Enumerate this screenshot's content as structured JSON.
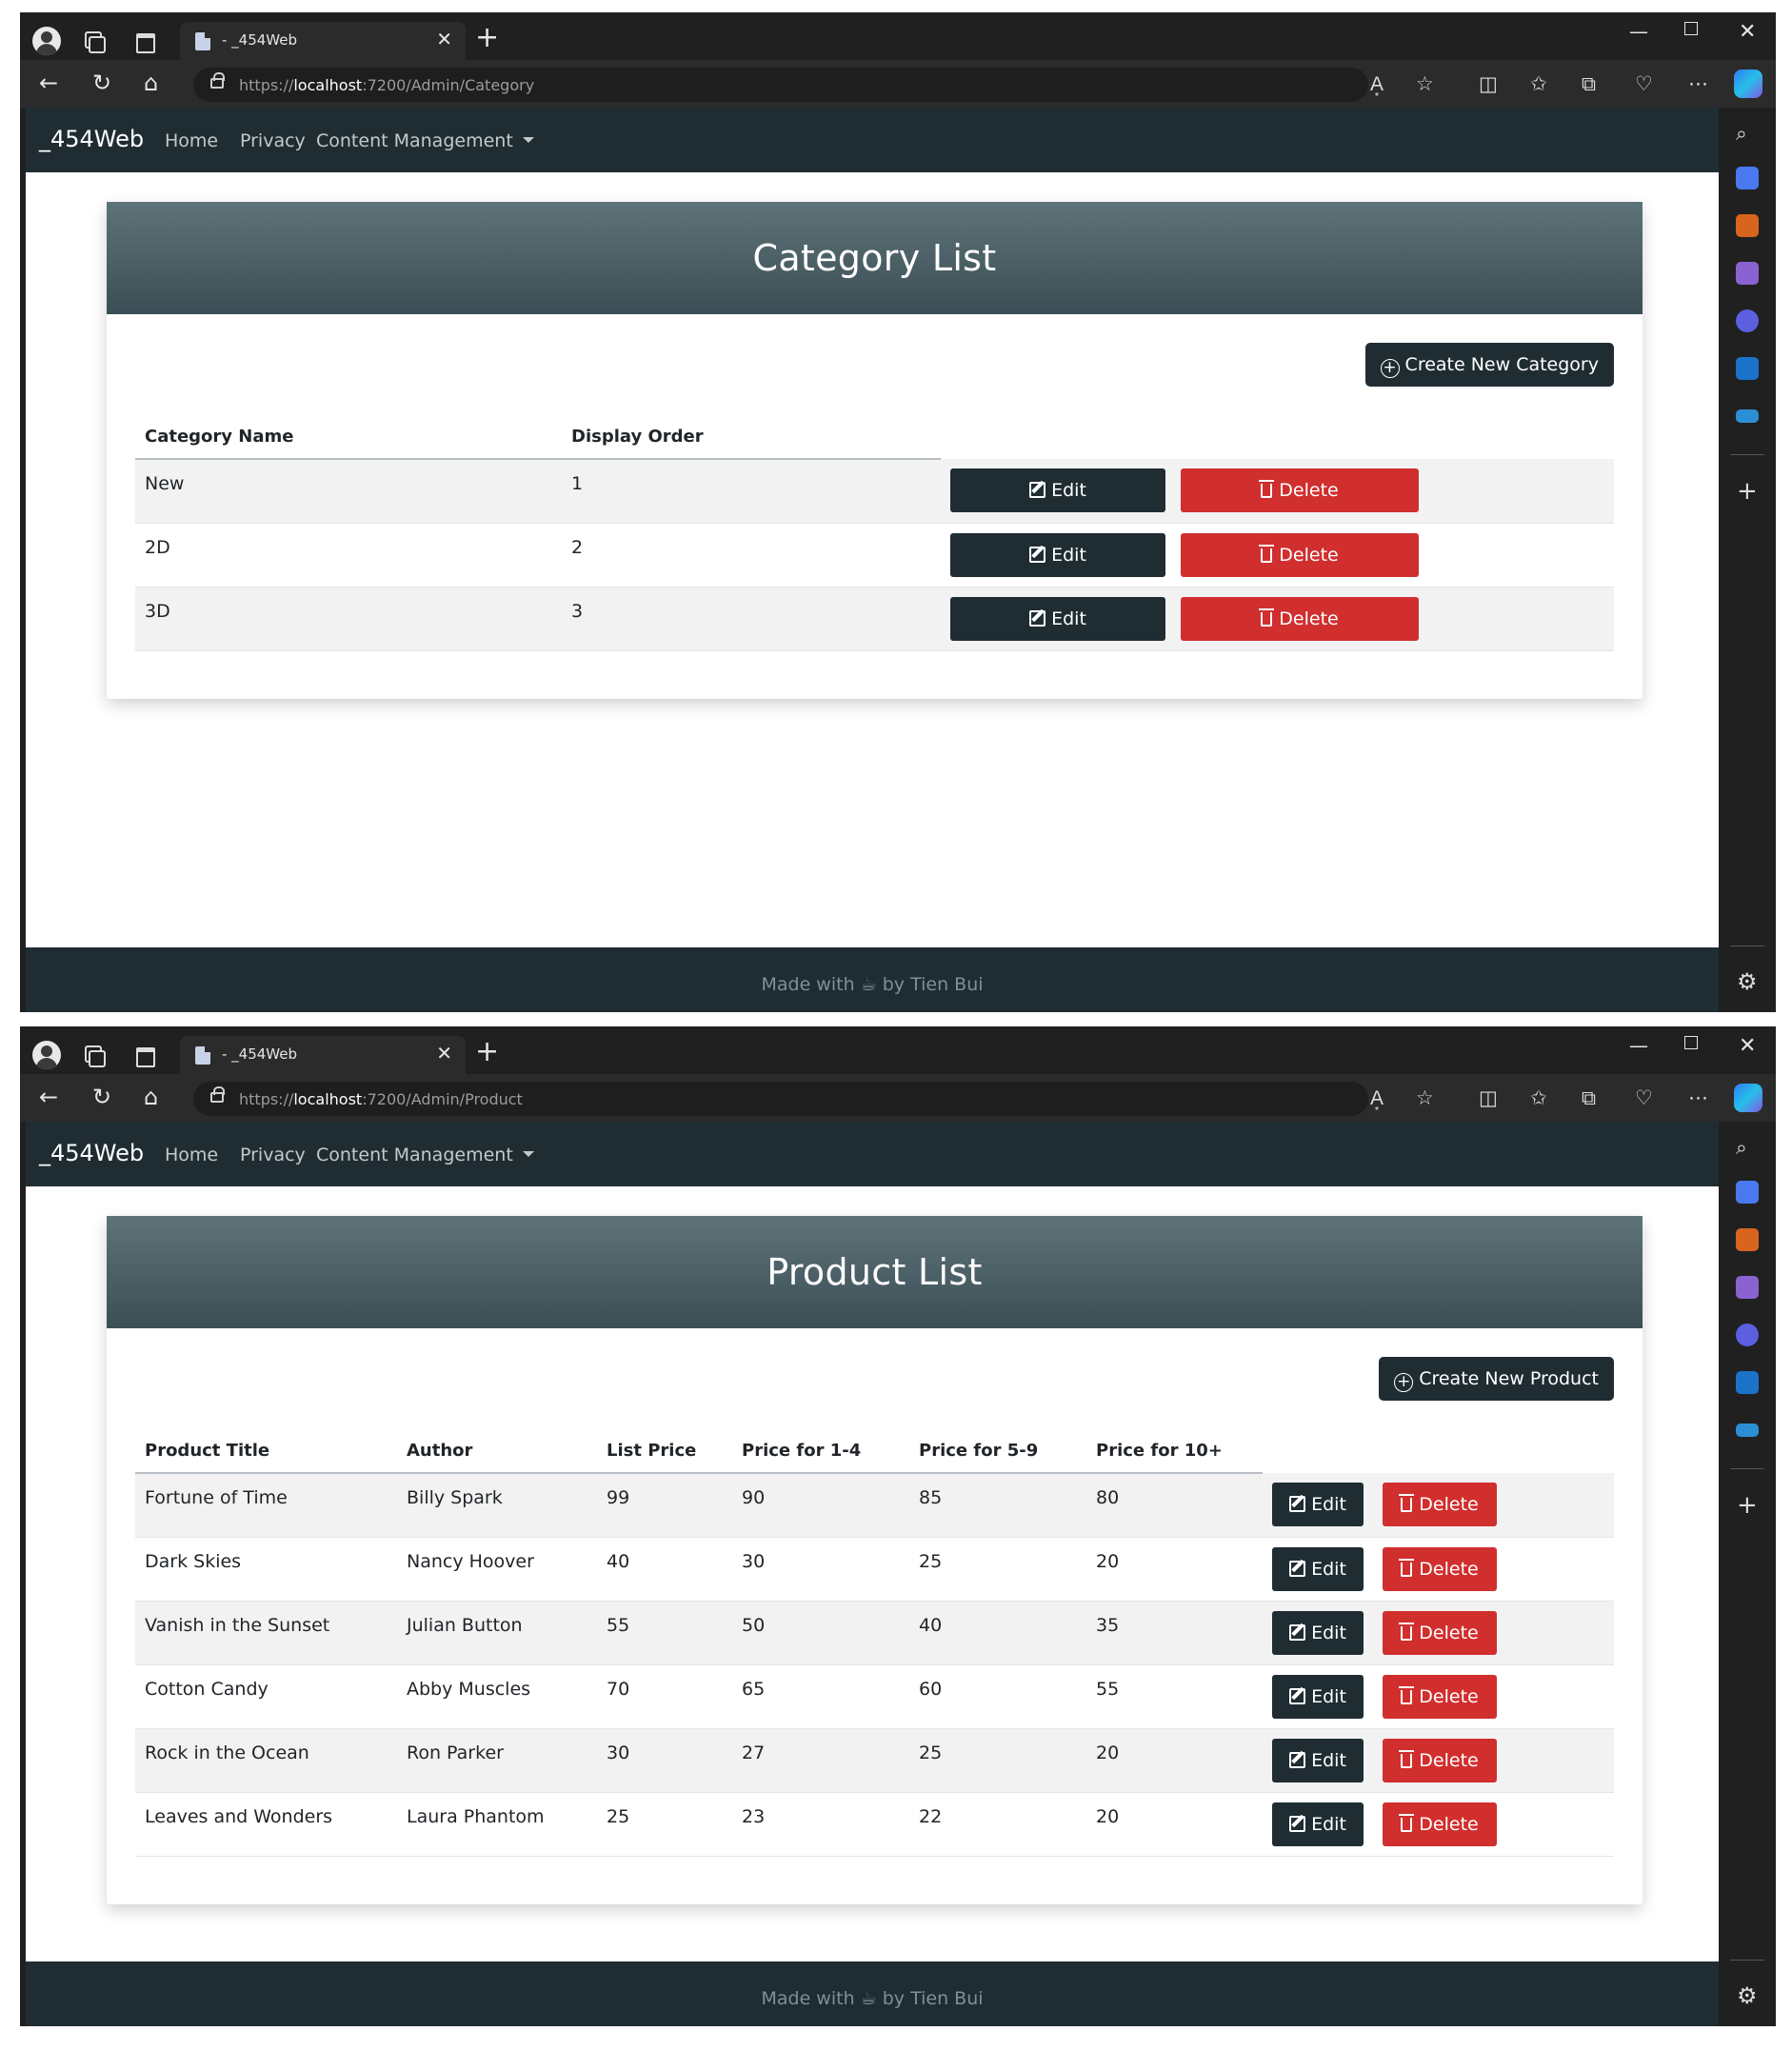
{
  "windows": [
    {
      "tab_title": "- _454Web",
      "url_scheme": "https://",
      "url_host": "localhost",
      "url_path": ":7200/Admin/Category",
      "nav": {
        "brand": "_454Web",
        "home": "Home",
        "privacy": "Privacy",
        "content": "Content Management"
      },
      "card_title": "Category List",
      "create_label": "Create New Category",
      "columns": [
        "Category Name",
        "Display Order"
      ],
      "rows": [
        [
          "New",
          "1"
        ],
        [
          "2D",
          "2"
        ],
        [
          "3D",
          "3"
        ]
      ],
      "edit_label": "Edit",
      "delete_label": "Delete",
      "footer_prefix": "Made with",
      "footer_suffix": "by Tien Bui"
    },
    {
      "tab_title": "- _454Web",
      "url_scheme": "https://",
      "url_host": "localhost",
      "url_path": ":7200/Admin/Product",
      "nav": {
        "brand": "_454Web",
        "home": "Home",
        "privacy": "Privacy",
        "content": "Content Management"
      },
      "card_title": "Product List",
      "create_label": "Create New Product",
      "columns": [
        "Product Title",
        "Author",
        "List Price",
        "Price for 1-4",
        "Price for 5-9",
        "Price for 10+"
      ],
      "rows": [
        [
          "Fortune of Time",
          "Billy Spark",
          "99",
          "90",
          "85",
          "80"
        ],
        [
          "Dark Skies",
          "Nancy Hoover",
          "40",
          "30",
          "25",
          "20"
        ],
        [
          "Vanish in the Sunset",
          "Julian Button",
          "55",
          "50",
          "40",
          "35"
        ],
        [
          "Cotton Candy",
          "Abby Muscles",
          "70",
          "65",
          "60",
          "55"
        ],
        [
          "Rock in the Ocean",
          "Ron Parker",
          "30",
          "27",
          "25",
          "20"
        ],
        [
          "Leaves and Wonders",
          "Laura Phantom",
          "25",
          "23",
          "22",
          "20"
        ]
      ],
      "edit_label": "Edit",
      "delete_label": "Delete",
      "footer_prefix": "Made with",
      "footer_suffix": "by Tien Bui"
    }
  ],
  "colors": {
    "navbar": "#1f2d33",
    "header_top": "#5e7379",
    "header_bottom": "#3b4e55",
    "delete": "#d12e2e"
  }
}
